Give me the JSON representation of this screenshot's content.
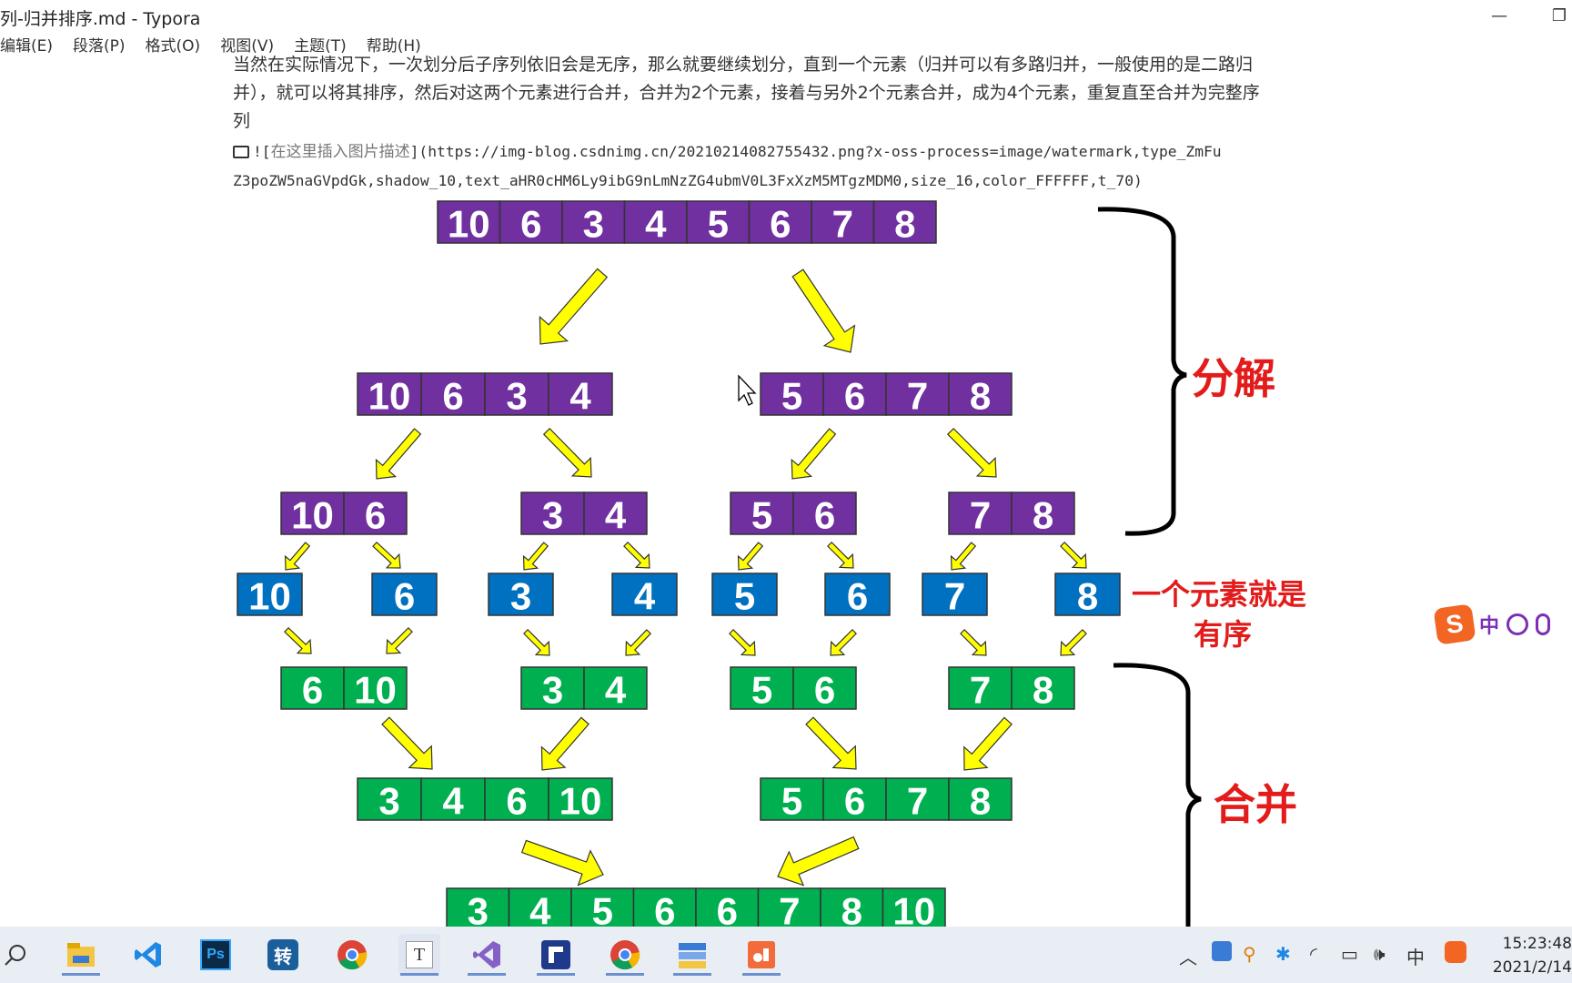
{
  "window": {
    "title": "列-归并排序.md - Typora",
    "minimize_glyph": "—",
    "restore_glyph": "❐"
  },
  "menu": [
    "编辑(E)",
    "段落(P)",
    "格式(O)",
    "视图(V)",
    "主题(T)",
    "帮助(H)"
  ],
  "document": {
    "para_line1": "当然在实际情况下，一次划分后子序列依旧会是无序，那么就要继续划分，直到一个元素（归并可以有多路归并，一般使用的是二路归",
    "para_line2": "并），就可以将其排序，然后对这两个元素进行合并，合并为2个元素，接着与另外2个元素合并，成为4个元素，重复直至合并为完整序",
    "para_line3": "列",
    "md_prefix": "![",
    "md_alt": "在这里插入图片描述",
    "md_url_line1": "](https://img-blog.csdnimg.cn/20210214082755432.png?x-oss-process=image/watermark,type_ZmFu",
    "md_url_line2": "Z3poZW5naGVpdGk,shadow_10,text_aHR0cHM6Ly9ibG9nLmNzZG4ubmV0L3FxXzM5MTgzMDM0,size_16,color_FFFFFF,t_70)"
  },
  "diagram": {
    "colors": {
      "split": "#7030a0",
      "single": "#0070c0",
      "merge": "#00b050",
      "arrow": "#ffff00",
      "label": "#e31b1b"
    },
    "split_level0": [
      "10",
      "6",
      "3",
      "4",
      "5",
      "6",
      "7",
      "8"
    ],
    "split_level1": [
      [
        "10",
        "6",
        "3",
        "4"
      ],
      [
        "5",
        "6",
        "7",
        "8"
      ]
    ],
    "split_level2": [
      [
        "10",
        "6"
      ],
      [
        "3",
        "4"
      ],
      [
        "5",
        "6"
      ],
      [
        "7",
        "8"
      ]
    ],
    "single_level": [
      "10",
      "6",
      "3",
      "4",
      "5",
      "6",
      "7",
      "8"
    ],
    "merge_level1": [
      [
        "6",
        "10"
      ],
      [
        "3",
        "4"
      ],
      [
        "5",
        "6"
      ],
      [
        "7",
        "8"
      ]
    ],
    "merge_level2": [
      [
        "3",
        "4",
        "6",
        "10"
      ],
      [
        "5",
        "6",
        "7",
        "8"
      ]
    ],
    "merge_level3": [
      "3",
      "4",
      "5",
      "6",
      "6",
      "7",
      "8",
      "10"
    ],
    "label_split": "分解",
    "label_single_line1": "一个元素就是",
    "label_single_line2": "有序",
    "label_merge": "合并"
  },
  "ime": {
    "logo": "S",
    "mode": "中"
  },
  "taskbar": {
    "apps": [
      "file-explorer",
      "vscode",
      "photoshop",
      "converter",
      "chrome",
      "typora",
      "visual-studio",
      "flowus",
      "chrome",
      "tools",
      "presenter"
    ],
    "converter_label": "转",
    "ps_label": "Ps",
    "typora_label": "T",
    "tray_ime": "中",
    "time": "15:23:48",
    "date": "2021/2/14"
  }
}
